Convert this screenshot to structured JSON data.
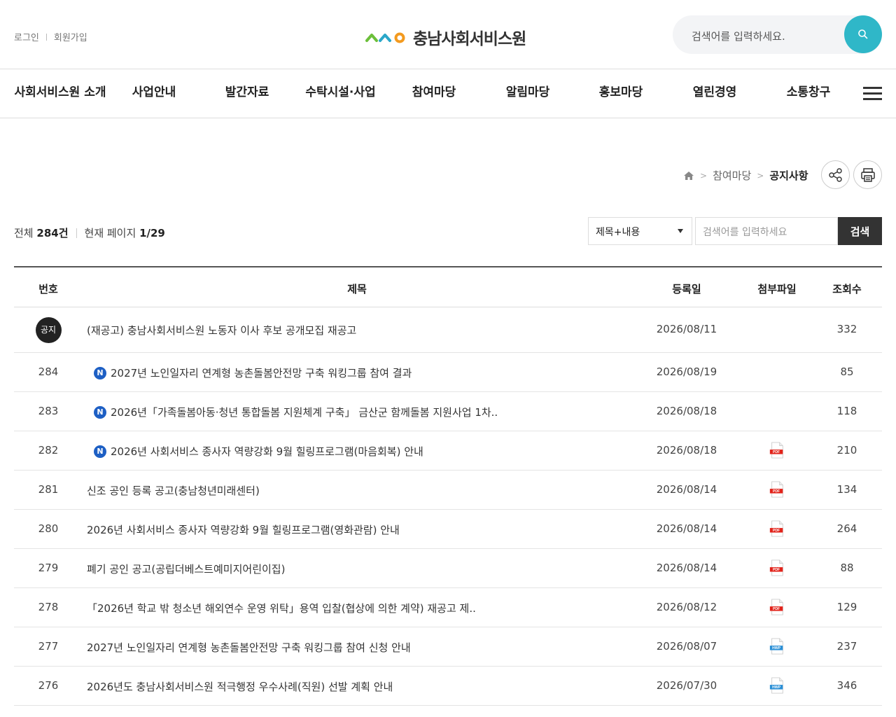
{
  "header": {
    "login": "로그인",
    "join": "회원가입",
    "logo_text": "충남사회서비스원",
    "search_placeholder": "검색어를 입력하세요."
  },
  "gnb": [
    "사회서비스원 소개",
    "사업안내",
    "발간자료",
    "수탁시설·사업",
    "참여마당",
    "알림마당",
    "홍보마당",
    "열린경영",
    "소통창구"
  ],
  "breadcrumb": {
    "level1": "참여마당",
    "current": "공지사항"
  },
  "summary": {
    "total_label": "전체",
    "total": "284건",
    "page_label": "현재 페이지",
    "page": "1/29"
  },
  "search": {
    "select_value": "제목+내용",
    "placeholder": "검색어를 입력하세요",
    "button": "검색"
  },
  "table": {
    "columns": [
      "번호",
      "제목",
      "등록일",
      "첨부파일",
      "조회수"
    ],
    "notice": {
      "badge": "공지",
      "title": "(재공고) 충남사회서비스원 노동자 이사 후보 공개모집 재공고",
      "date": "2026/08/11",
      "views": "332"
    },
    "rows": [
      {
        "no": "284",
        "new": true,
        "title": "2027년 노인일자리 연계형 농촌돌봄안전망 구축 워킹그룹 참여 결과",
        "date": "2026/08/19",
        "file": "",
        "views": "85"
      },
      {
        "no": "283",
        "new": true,
        "title": "2026년「가족돌봄아동·청년 통합돌봄 지원체계 구축」 금산군 함께돌봄 지원사업 1차..",
        "date": "2026/08/18",
        "file": "",
        "views": "118"
      },
      {
        "no": "282",
        "new": true,
        "title": "2026년 사회서비스 종사자 역량강화 9월 힐링프로그램(마음회복) 안내",
        "date": "2026/08/18",
        "file": "pdf",
        "views": "210"
      },
      {
        "no": "281",
        "new": false,
        "title": "신조 공인 등록 공고(충남청년미래센터)",
        "date": "2026/08/14",
        "file": "pdf",
        "views": "134"
      },
      {
        "no": "280",
        "new": false,
        "title": "2026년 사회서비스 종사자 역량강화 9월 힐링프로그램(영화관람) 안내",
        "date": "2026/08/14",
        "file": "pdf",
        "views": "264"
      },
      {
        "no": "279",
        "new": false,
        "title": "폐기 공인 공고(공립더베스트예미지어린이집)",
        "date": "2026/08/14",
        "file": "pdf",
        "views": "88"
      },
      {
        "no": "278",
        "new": false,
        "title": "「2026년 학교 밖 청소년 해외연수 운영 위탁」용역 입찰(협상에 의한 계약) 재공고 제..",
        "date": "2026/08/12",
        "file": "pdf",
        "views": "129"
      },
      {
        "no": "277",
        "new": false,
        "title": "2027년 노인일자리 연계형 농촌돌봄안전망 구축 워킹그룹 참여 신청 안내",
        "date": "2026/08/07",
        "file": "hwp",
        "views": "237"
      },
      {
        "no": "276",
        "new": false,
        "title": "2026년도 충남사회서비스원 적극행정 우수사례(직원) 선발 계획 안내",
        "date": "2026/07/30",
        "file": "hwp",
        "views": "346"
      }
    ]
  },
  "new_badge": "N",
  "file_labels": {
    "pdf": "PDF",
    "hwp": "HWP"
  },
  "colors": {
    "accent": "#2fb7c8",
    "new_badge": "#1d5fc4",
    "pdf": "#e2231a",
    "hwp": "#2a8fd6"
  }
}
